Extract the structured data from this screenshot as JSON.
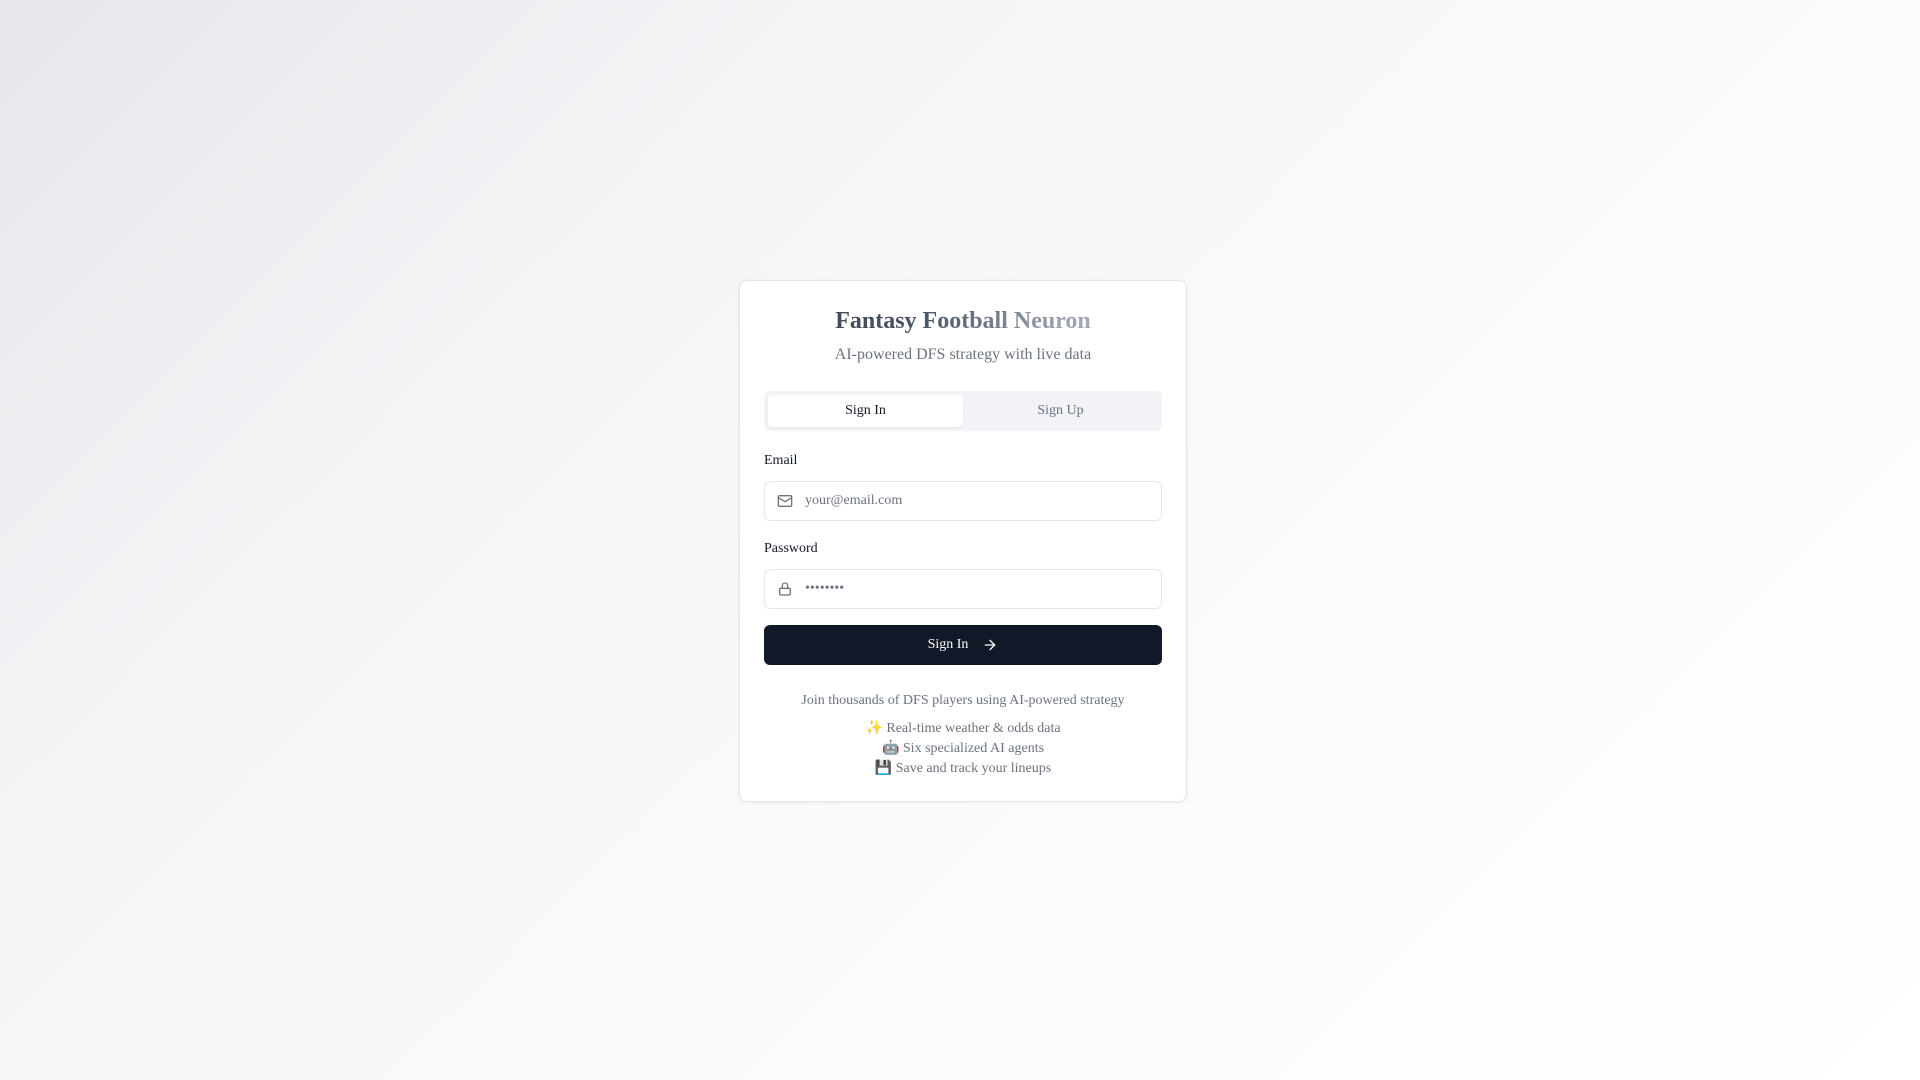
{
  "header": {
    "title": "Fantasy Football Neuron",
    "subtitle": "AI-powered DFS strategy with live data"
  },
  "tabs": [
    {
      "label": "Sign In",
      "active": true
    },
    {
      "label": "Sign Up",
      "active": false
    }
  ],
  "form": {
    "email": {
      "label": "Email",
      "placeholder": "your@email.com",
      "value": "",
      "icon": "mail-icon"
    },
    "password": {
      "label": "Password",
      "placeholder": "••••••••",
      "value": "",
      "icon": "lock-icon"
    },
    "submit_label": "Sign In",
    "submit_icon": "arrow-right-icon"
  },
  "footer": {
    "join_text": "Join thousands of DFS players using AI-powered strategy",
    "features": [
      "✨ Real-time weather & odds data",
      "🤖 Six specialized AI agents",
      "💾 Save and track your lineups"
    ]
  },
  "colors": {
    "primary": "#111827",
    "muted": "#6b7280",
    "border": "#e5e7eb",
    "tab_background": "#f1f3f6"
  }
}
